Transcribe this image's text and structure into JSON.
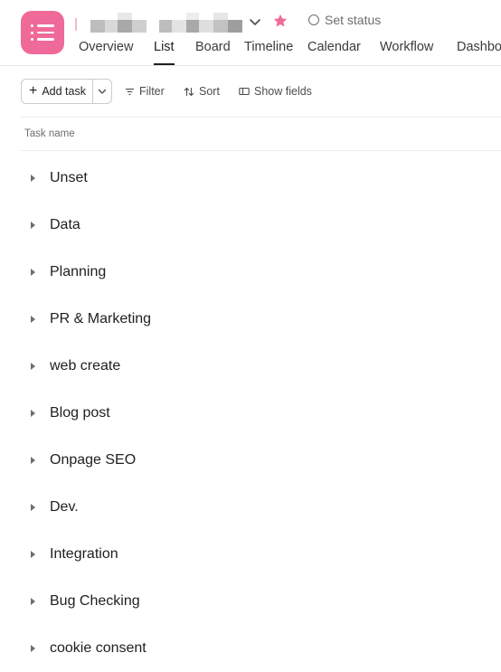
{
  "colors": {
    "accent_pink": "#f06a99",
    "text_primary": "#1e1f21",
    "text_secondary": "#6d6e6f",
    "border": "#cfcbcb"
  },
  "header": {
    "project_icon": "list-icon",
    "set_status_label": "Set status",
    "tabs": [
      {
        "label": "Overview",
        "active": false
      },
      {
        "label": "List",
        "active": true
      },
      {
        "label": "Board",
        "active": false
      },
      {
        "label": "Timeline",
        "active": false
      },
      {
        "label": "Calendar",
        "active": false
      },
      {
        "label": "Workflow",
        "active": false
      },
      {
        "label": "Dashbo",
        "active": false
      }
    ]
  },
  "toolbar": {
    "add_task_label": "Add task",
    "filter_label": "Filter",
    "sort_label": "Sort",
    "show_fields_label": "Show fields"
  },
  "list": {
    "column_header": "Task name",
    "sections": [
      "Unset",
      "Data",
      "Planning",
      "PR & Marketing",
      "web create",
      "Blog post",
      "Onpage SEO",
      "Dev.",
      "Integration",
      "Bug Checking",
      "cookie consent"
    ]
  }
}
